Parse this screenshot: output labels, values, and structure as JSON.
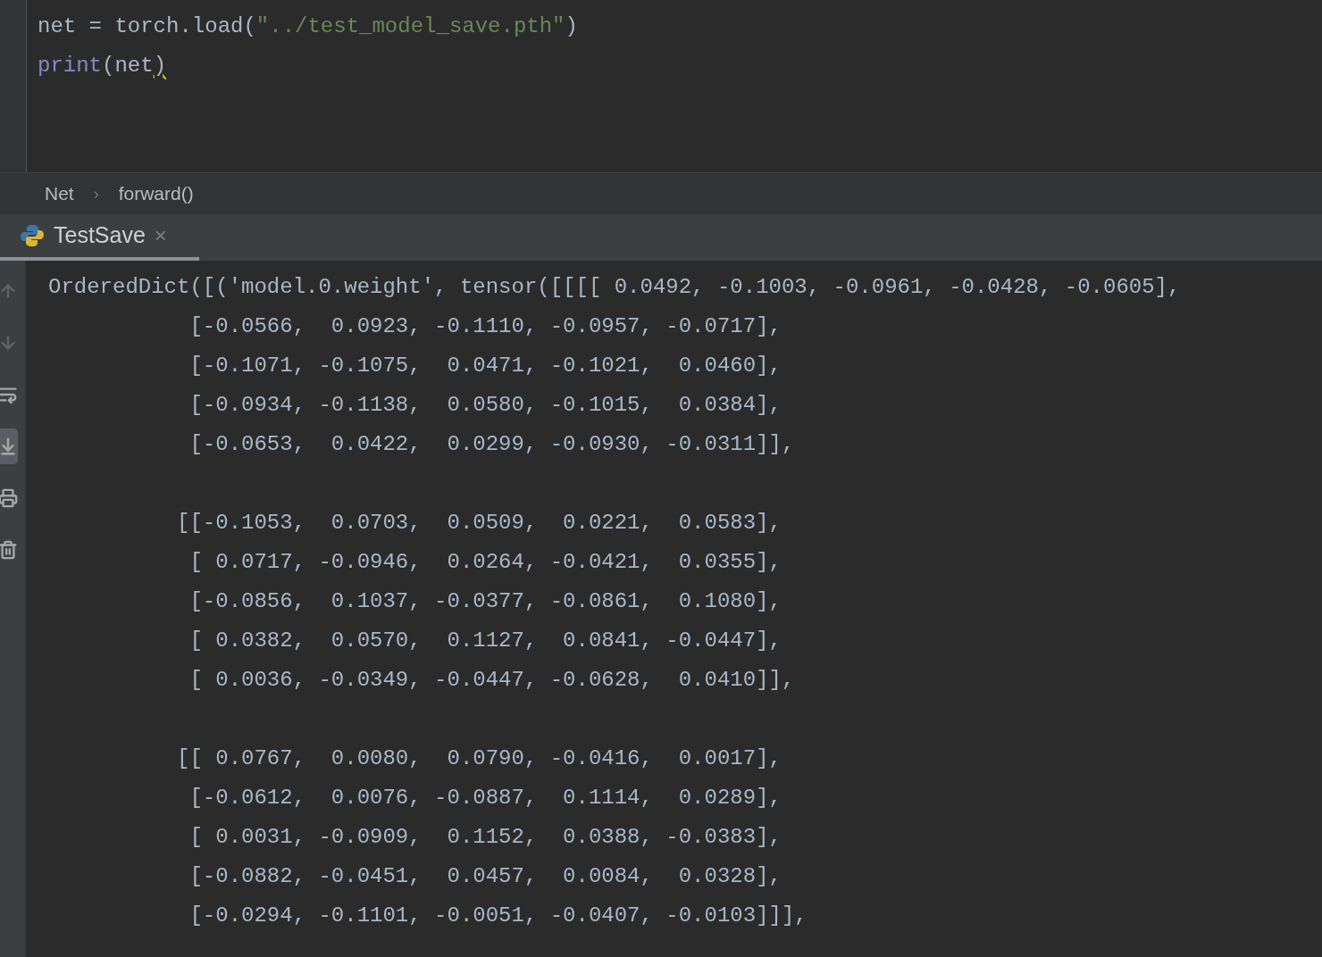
{
  "editor": {
    "lines": [
      [
        {
          "kind": "plain",
          "text": "net = torch.load("
        },
        {
          "kind": "string",
          "text": "\"../test_model_save.pth\""
        },
        {
          "kind": "plain",
          "text": ")"
        }
      ],
      [
        {
          "kind": "builtin",
          "text": "print"
        },
        {
          "kind": "plain",
          "text": "(net"
        },
        {
          "kind": "warning",
          "text": ")"
        }
      ]
    ]
  },
  "breadcrumb": [
    "Net",
    "forward()"
  ],
  "breadcrumb_separator": "›",
  "run_tabs": [
    {
      "label": "TestSave",
      "selected": true,
      "close": "×"
    }
  ],
  "console_toolbar": [
    {
      "kind": "up",
      "disabled": true,
      "selected": false
    },
    {
      "kind": "down",
      "disabled": true,
      "selected": false
    },
    {
      "kind": "wrap",
      "disabled": false,
      "selected": false
    },
    {
      "kind": "scroll_end",
      "disabled": false,
      "selected": true
    },
    {
      "kind": "print",
      "disabled": false,
      "selected": false
    },
    {
      "kind": "delete",
      "disabled": false,
      "selected": false
    }
  ],
  "console_output": [
    [
      "OrderedDict([('model.0.weight', tensor([[[[ 0.0492, -0.1003, -0.0961, -0.0428, -0.0605],",
      "           [-0.0566,  0.0923, -0.1110, -0.0957, -0.0717],",
      "           [-0.1071, -0.1075,  0.0471, -0.1021,  0.0460],",
      "           [-0.0934, -0.1138,  0.0580, -0.1015,  0.0384],",
      "           [-0.0653,  0.0422,  0.0299, -0.0930, -0.0311]],"
    ],
    [
      "          [[-0.1053,  0.0703,  0.0509,  0.0221,  0.0583],",
      "           [ 0.0717, -0.0946,  0.0264, -0.0421,  0.0355],",
      "           [-0.0856,  0.1037, -0.0377, -0.0861,  0.1080],",
      "           [ 0.0382,  0.0570,  0.1127,  0.0841, -0.0447],",
      "           [ 0.0036, -0.0349, -0.0447, -0.0628,  0.0410]],"
    ],
    [
      "          [[ 0.0767,  0.0080,  0.0790, -0.0416,  0.0017],",
      "           [-0.0612,  0.0076, -0.0887,  0.1114,  0.0289],",
      "           [ 0.0031, -0.0909,  0.1152,  0.0388, -0.0383],",
      "           [-0.0882, -0.0451,  0.0457,  0.0084,  0.0328],",
      "           [-0.0294, -0.1101, -0.0051, -0.0407, -0.0103]]],"
    ]
  ]
}
